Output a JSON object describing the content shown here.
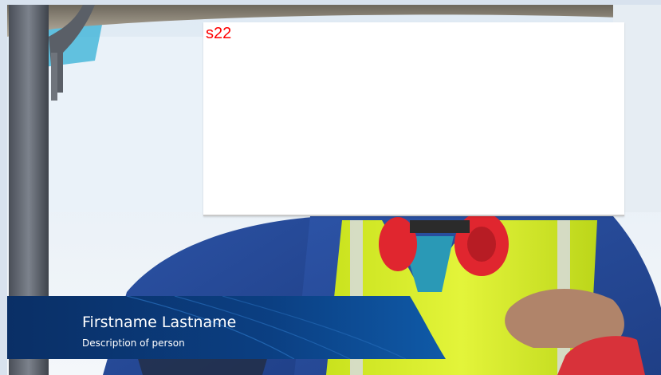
{
  "placeholder": {
    "label": "s22"
  },
  "caption": {
    "name": "Firstname Lastname",
    "description": "Description of person"
  },
  "colors": {
    "placeholder_label": "#ff0000",
    "caption_band": "#0b3a78",
    "caption_band_light": "#0f5aa8",
    "vest": "#d9ef2a",
    "shirt": "#2a4fa0",
    "earmuff": "#e0262f",
    "sky": "#e9f1f8"
  },
  "image": {
    "subject": "worker-photo"
  }
}
